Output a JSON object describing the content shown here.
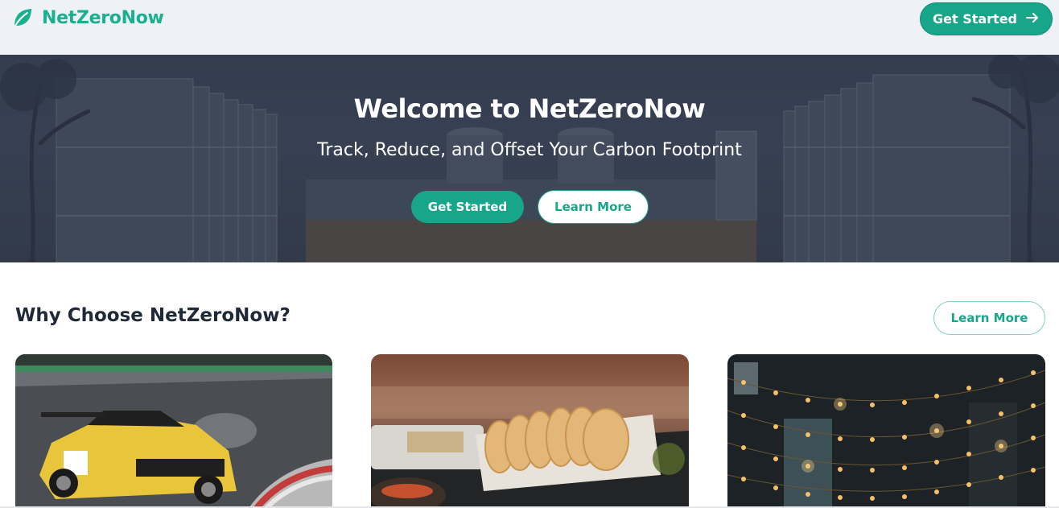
{
  "header": {
    "brand": "NetZeroNow",
    "logo_icon": "leaf-icon",
    "cta_label": "Get Started",
    "cta_icon": "arrow-right-icon"
  },
  "hero": {
    "title": "Welcome to NetZeroNow",
    "subtitle": "Track, Reduce, and Offset Your Carbon Footprint",
    "primary_button": "Get Started",
    "secondary_button": "Learn More"
  },
  "section": {
    "title": "Why Choose NetZeroNow?",
    "learn_more": "Learn More"
  },
  "cards": [
    {
      "image": "race-car-photo"
    },
    {
      "image": "bread-photo"
    },
    {
      "image": "string-lights-photo"
    }
  ],
  "colors": {
    "brand": "#18a68a",
    "brand_text": "#18b08f",
    "header_bg": "#eef1f6",
    "heading": "#1f2937"
  }
}
